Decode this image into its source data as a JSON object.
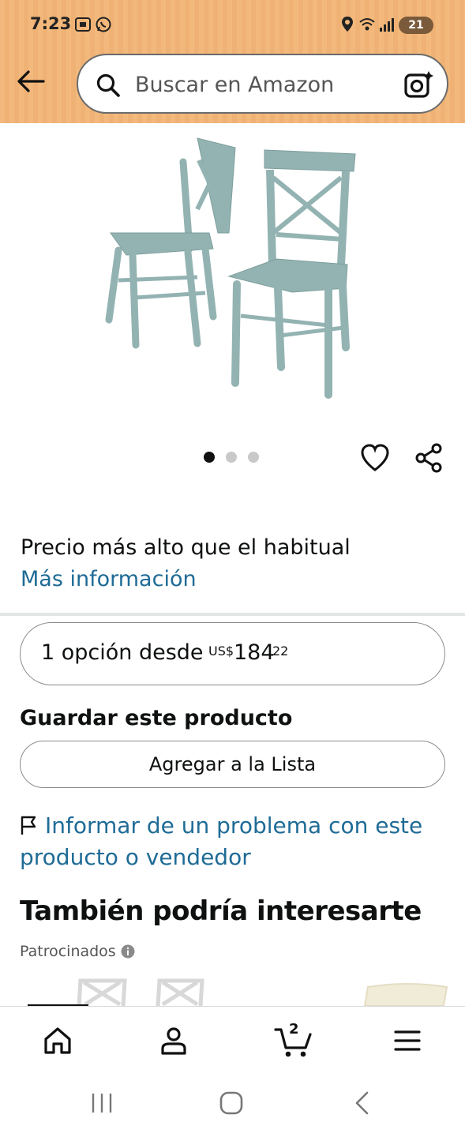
{
  "status_bar": {
    "time": "7:23",
    "battery": "21",
    "icons": [
      "screenshot-icon",
      "whatsapp-icon",
      "location-icon",
      "wifi-icon",
      "signal-icon",
      "battery-icon"
    ]
  },
  "header": {
    "search_placeholder": "Buscar en Amazon",
    "icons": [
      "back-arrow-icon",
      "search-icon",
      "camera-lens-icon"
    ]
  },
  "product": {
    "image_count": 3,
    "active_image_index": 0,
    "colors": {
      "chair": "#93b3b2",
      "chair_shade": "#7c9e9c"
    }
  },
  "price_note": {
    "text": "Precio más alto que el habitual",
    "link": "Más información"
  },
  "offer": {
    "text": "1 opción desde",
    "currency": "US$",
    "whole": "184",
    "fraction": "22"
  },
  "save": {
    "title": "Guardar este producto",
    "button": "Agregar a la Lista"
  },
  "report": {
    "text": "Informar de un problema con este producto o vendedor"
  },
  "recommendations": {
    "title": "También podría interesarte",
    "sponsored": "Patrocinados"
  },
  "bottom_nav": {
    "cart_count": "2",
    "items": [
      "home-icon",
      "account-icon",
      "cart-icon",
      "menu-icon"
    ]
  },
  "colors": {
    "header_bg": "#f3b97c",
    "link": "#1f6b96",
    "text": "#0f1111"
  }
}
